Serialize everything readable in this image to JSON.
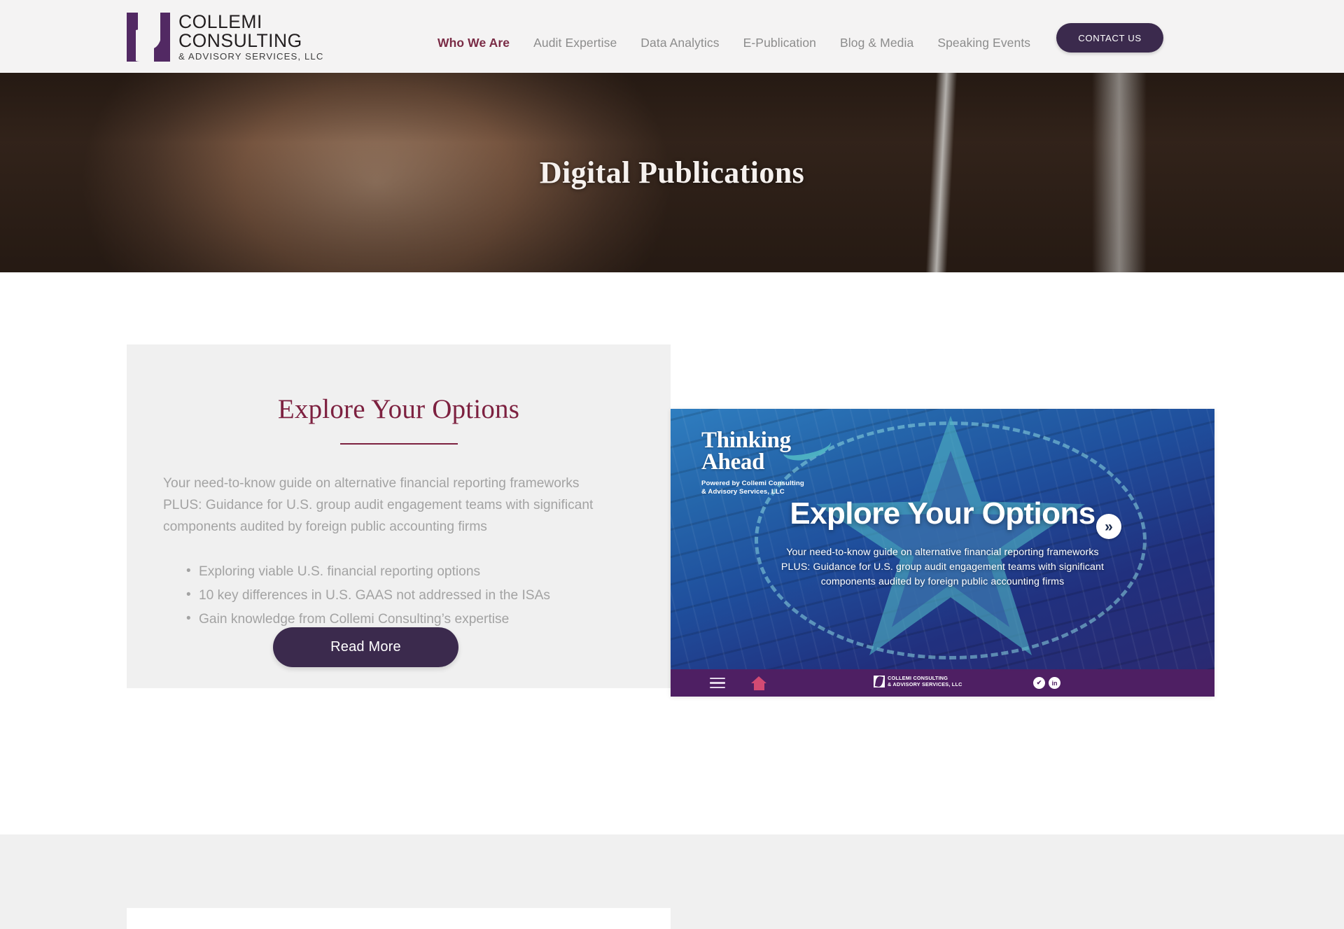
{
  "header": {
    "logo": {
      "line1": "COLLEMI",
      "line2": "CONSULTING",
      "line3": "& ADVISORY SERVICES, LLC",
      "mark_name": "collemi-logo-mark"
    },
    "nav": [
      {
        "label": "Who We Are",
        "active": true
      },
      {
        "label": "Audit Expertise",
        "active": false
      },
      {
        "label": "Data Analytics",
        "active": false
      },
      {
        "label": "E-Publication",
        "active": false
      },
      {
        "label": "Blog & Media",
        "active": false
      },
      {
        "label": "Speaking Events",
        "active": false
      }
    ],
    "contact_button": "CONTACT US",
    "colors": {
      "accent_purple": "#3b2a4d",
      "active_link": "#7a2b45",
      "nav_link": "#8c8c8c",
      "bar_bg": "#f4f3f3"
    }
  },
  "hero": {
    "title": "Digital Publications"
  },
  "card": {
    "heading": "Explore Your Options",
    "heading_color": "#7d2140",
    "paragraph_line1": "Your need-to-know guide on alternative financial reporting",
    "paragraph_line2": "frameworks",
    "paragraph_line3": "PLUS: Guidance for U.S. group audit engagement teams with",
    "paragraph_line4": "significant components audited by foreign public accounting firms",
    "bullets": [
      "Exploring viable U.S. financial reporting options",
      "10 key differences in U.S. GAAS not addressed in the ISAs",
      "Gain knowledge from Collemi Consulting’s expertise"
    ],
    "read_more_label": "Read More"
  },
  "publication": {
    "masthead_line1": "Thinking",
    "masthead_line2": "Ahead",
    "powered_by_line1": "Powered by Collemi Consulting",
    "powered_by_line2": "& Advisory Services, LLC",
    "headline": "Explore Your Options",
    "sub_line1": "Your need-to-know guide on alternative financial reporting frameworks",
    "sub_line2": "PLUS: Guidance for U.S. group audit engagement teams with significant",
    "sub_line3": "components audited by foreign public accounting firms",
    "next_arrow": "»",
    "toolbar": {
      "logo_line1": "COLLEMI CONSULTING",
      "logo_line2": "& ADVISORY SERVICES, LLC",
      "social": [
        {
          "name": "twitter-icon",
          "glyph": "✔"
        },
        {
          "name": "linkedin-icon",
          "glyph": "in"
        }
      ]
    },
    "colors": {
      "toolbar_bg": "#4e1f63",
      "page_blue": "#2566ab",
      "home_icon": "#d24a73"
    }
  }
}
